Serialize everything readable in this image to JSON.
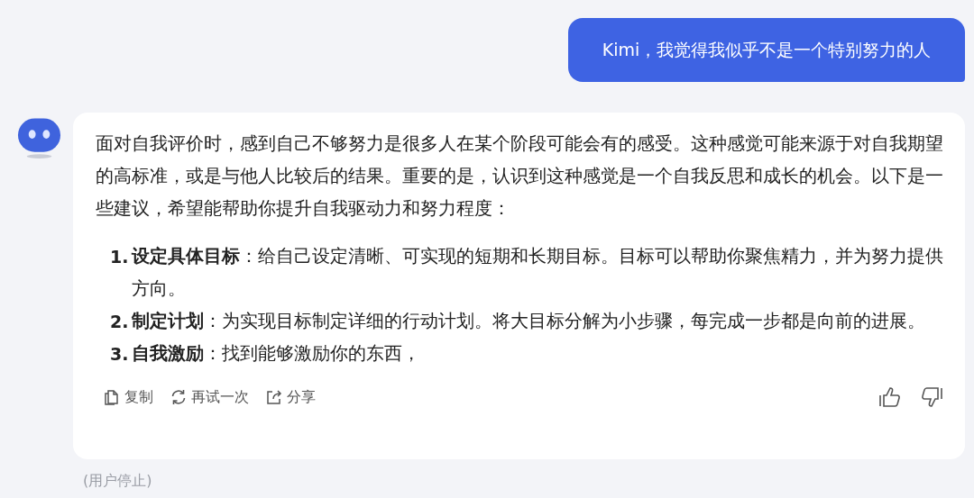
{
  "user_message": {
    "text": "Kimi，我觉得我似乎不是一个特别努力的人"
  },
  "reply": {
    "paragraph": "面对自我评价时，感到自己不够努力是很多人在某个阶段可能会有的感受。这种感觉可能来源于对自我期望的高标准，或是与他人比较后的结果。重要的是，认识到这种感觉是一个自我反思和成长的机会。以下是一些建议，希望能帮助你提升自我驱动力和努力程度：",
    "list": [
      {
        "number": "1.",
        "text": "**设定具体目标**：给自己设定清晰、可实现的短期和长期目标。目标可以帮助你聚焦精力，并为努力提供方向。"
      },
      {
        "number": "2.",
        "text": "**制定计划**：为实现目标制定详细的行动计划。将大目标分解为小步骤，每完成一步都是向前的进展。"
      },
      {
        "number": "3.",
        "text": "**自我激励**：找到能够激励你的东西，"
      }
    ],
    "actions": [
      {
        "kind": "copy",
        "label": "复制"
      },
      {
        "kind": "retry",
        "label": "再试一次"
      },
      {
        "kind": "share",
        "label": "分享"
      }
    ],
    "feedback": [
      {
        "kind": "like"
      },
      {
        "kind": "dislike"
      }
    ]
  },
  "status": "(用户停止)"
}
